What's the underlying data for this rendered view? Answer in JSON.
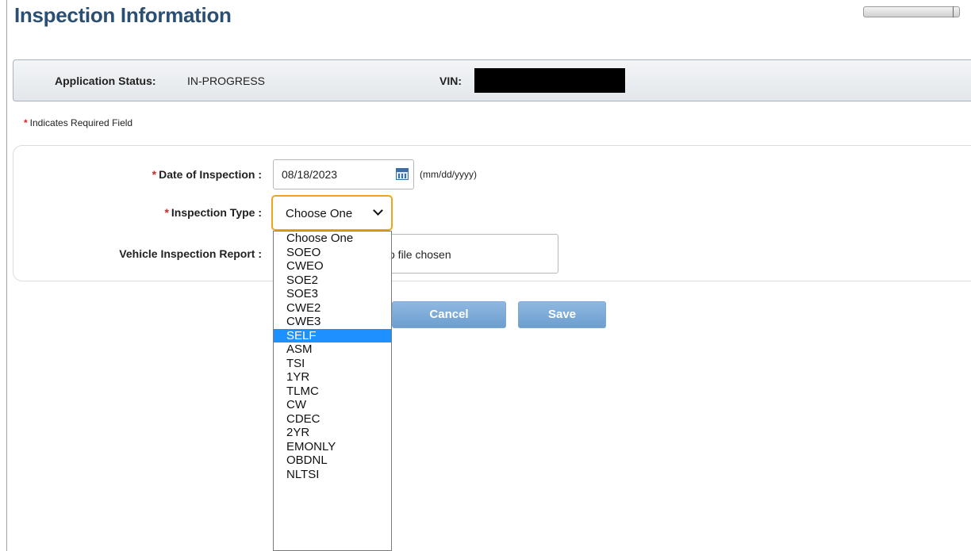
{
  "page": {
    "title": "Inspection Information"
  },
  "status": {
    "label": "Application Status:",
    "value": "IN-PROGRESS",
    "vin_label": "VIN:"
  },
  "required_note": {
    "star": "*",
    "text": "Indicates Required Field"
  },
  "form": {
    "date": {
      "star": "*",
      "label": "Date of Inspection :",
      "value": "08/18/2023",
      "hint": "(mm/dd/yyyy)"
    },
    "type": {
      "star": "*",
      "label": "Inspection Type :",
      "value": "Choose One"
    },
    "report": {
      "label": "Vehicle Inspection Report :",
      "file_text": "o file chosen"
    }
  },
  "buttons": {
    "cancel": "Cancel",
    "save": "Save"
  },
  "dropdown": {
    "selected": "SELF",
    "options": [
      "Choose One",
      "SOEO",
      "CWEO",
      "SOE2",
      "SOE3",
      "CWE2",
      "CWE3",
      "SELF",
      "ASM",
      "TSI",
      "1YR",
      "TLMC",
      "CW",
      "CDEC",
      "2YR",
      "EMONLY",
      "OBDNL",
      "NLTSI"
    ]
  },
  "colors": {
    "title": "#2a4f73",
    "required_star": "#e02020",
    "select_focus": "#f0a31c",
    "option_highlight": "#1e90ff",
    "button": "#7aa9d6"
  },
  "icons": {
    "calendar": "calendar-icon",
    "dropdown": "chevron-down-icon"
  }
}
